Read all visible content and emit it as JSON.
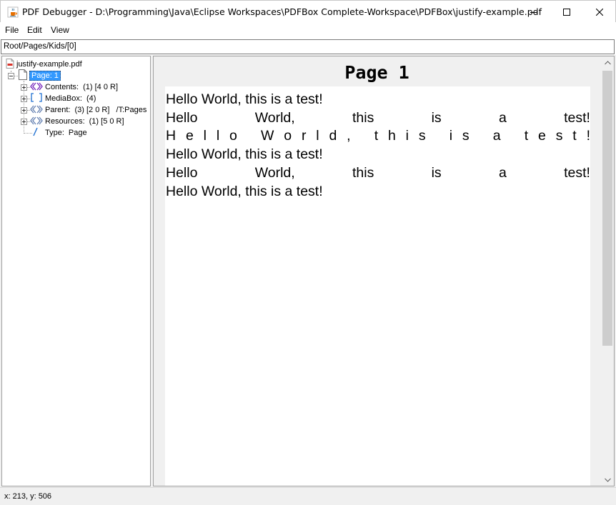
{
  "window": {
    "title": "PDF Debugger - D:\\Programming\\Java\\Eclipse Workspaces\\PDFBox Complete-Workspace\\PDFBox\\justify-example.pdf",
    "icon": "java-cup-icon"
  },
  "menu": {
    "items": [
      "File",
      "Edit",
      "View"
    ]
  },
  "path": {
    "value": "Root/Pages/Kids/[0]"
  },
  "tree": {
    "root": {
      "label": "justify-example.pdf",
      "icon": "pdf-file-icon"
    },
    "page": {
      "label": "Page: 1",
      "icon": "page-icon",
      "selected": true
    },
    "children": [
      {
        "key": "Contents:",
        "value": "(1) [4 0 R]",
        "icon": "indirect-object-icon"
      },
      {
        "key": "MediaBox:",
        "value": "(4)",
        "icon": "array-icon"
      },
      {
        "key": "Parent:",
        "value": "(3) [2 0 R]   /T:Pages",
        "icon": "indirect-object-icon"
      },
      {
        "key": "Resources:",
        "value": "(1) [5 0 R]",
        "icon": "indirect-object-icon"
      },
      {
        "key": "Type:",
        "value": "Page",
        "icon": "name-icon"
      }
    ]
  },
  "viewer": {
    "title": "Page 1",
    "lines": [
      {
        "mode": "normal",
        "text": "Hello World, this is a test!"
      },
      {
        "mode": "word-justify",
        "text": "Hello World, this is a test!"
      },
      {
        "mode": "char-justify",
        "text": "Hello World, this is a test!"
      },
      {
        "mode": "normal",
        "text": "Hello World, this is a test!"
      },
      {
        "mode": "word-justify",
        "text": "Hello World, this is a test!"
      },
      {
        "mode": "normal",
        "text": "Hello World, this is a test!"
      }
    ]
  },
  "status": {
    "text": "x: 213, y: 506"
  },
  "colors": {
    "selection": "#3399ff",
    "viewer_background": "#f0f0f0",
    "page_background": "#ffffff",
    "contents_icon": "#7b2fbe",
    "array_icon": "#1f6fd1",
    "name_icon": "#1f6fd1"
  }
}
